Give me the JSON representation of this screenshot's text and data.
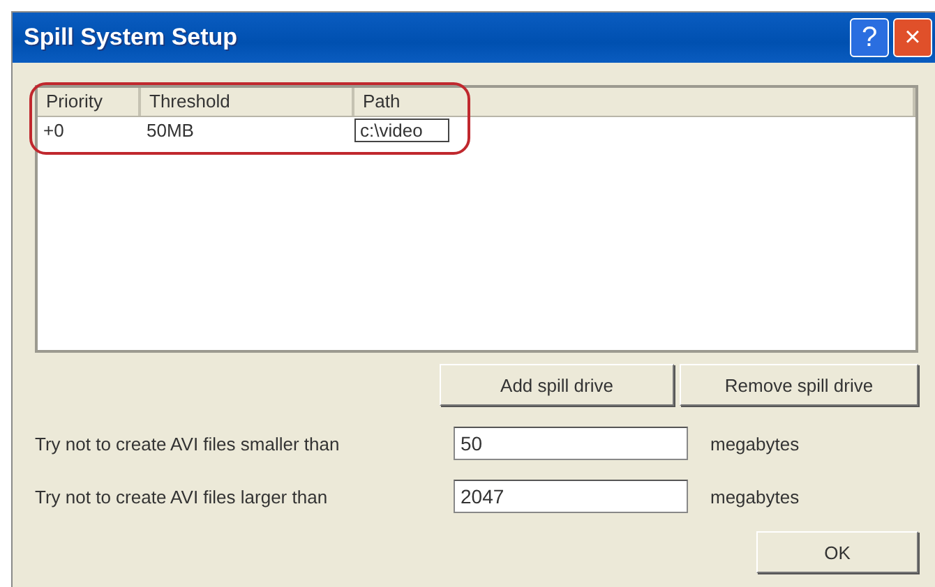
{
  "window": {
    "title": "Spill System Setup",
    "buttons": [
      "?",
      "×"
    ]
  },
  "table": {
    "columns": [
      "Priority",
      "Threshold",
      "Path"
    ],
    "rows": [
      {
        "cells": [
          "+0",
          "50MB",
          "c:\\video"
        ],
        "editing": true
      }
    ]
  },
  "list_buttons": [
    "Add spill drive",
    "Remove spill drive"
  ],
  "fields": [
    {
      "label": "Try not to create AVI files smaller than",
      "value": "50",
      "unit": "megabytes"
    },
    {
      "label": "Try not to create AVI files larger than",
      "value": "2047",
      "unit": "megabytes"
    }
  ],
  "buttons": [
    "OK"
  ]
}
